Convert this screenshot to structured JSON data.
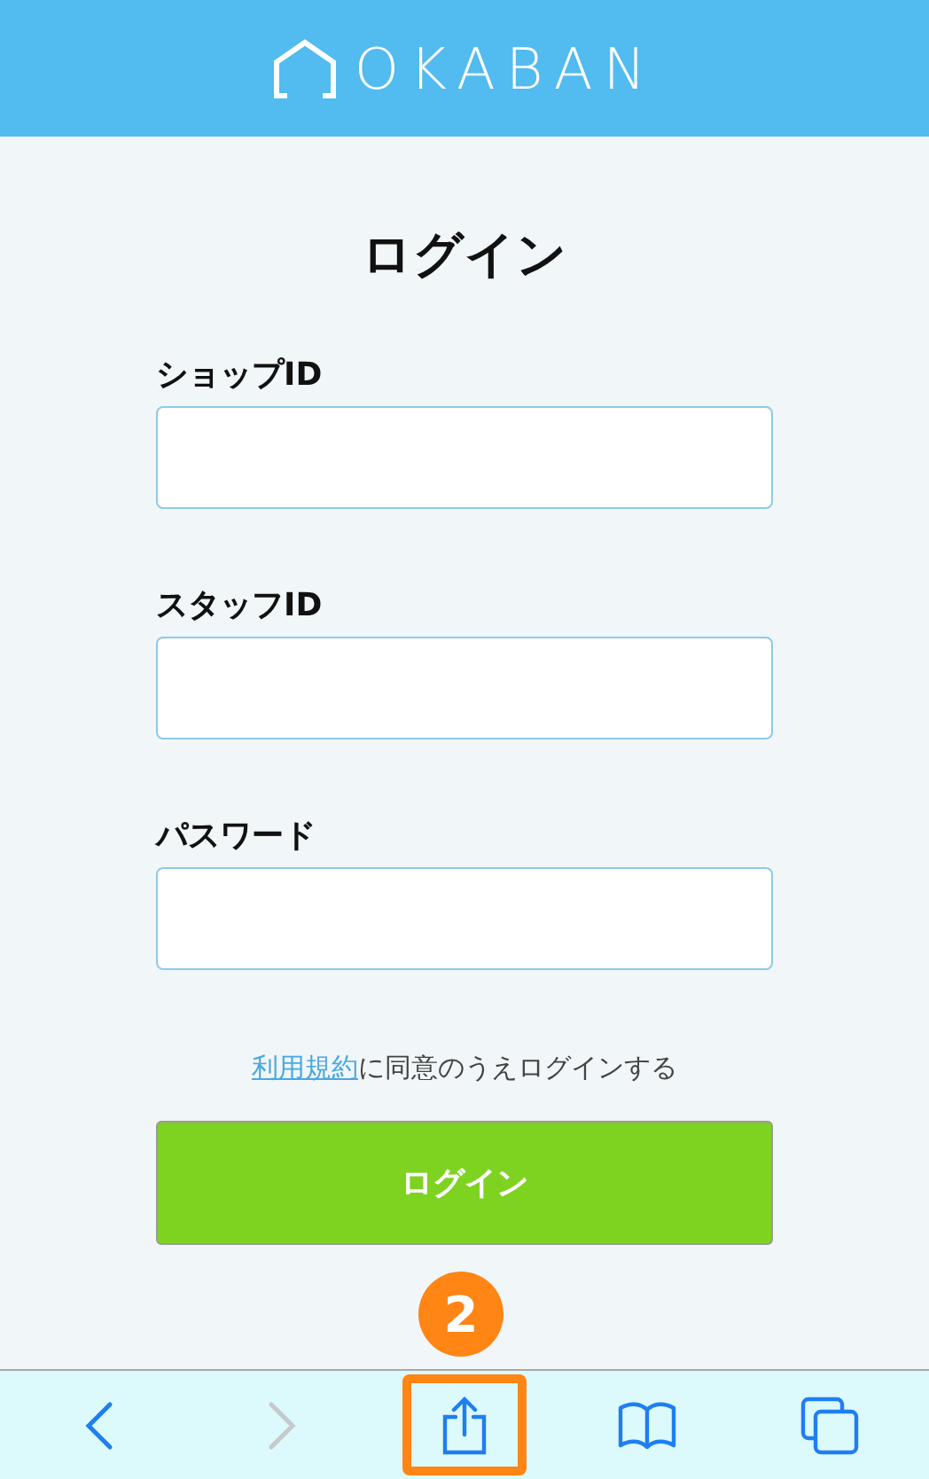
{
  "header": {
    "logo": "OKABAN"
  },
  "title": "ログイン",
  "fields": [
    {
      "label": "ショップID"
    },
    {
      "label": "スタッフID"
    },
    {
      "label": "パスワード"
    }
  ],
  "terms": {
    "link": "利用規約",
    "text": "に同意のうえログインする"
  },
  "submit": "ログイン",
  "callout": {
    "number": "2"
  },
  "toolbar": [
    {
      "kind": "back",
      "disabled": false,
      "highlighted": false
    },
    {
      "kind": "forward",
      "disabled": true,
      "highlighted": false
    },
    {
      "kind": "share",
      "disabled": false,
      "highlighted": true
    },
    {
      "kind": "bookmarks",
      "disabled": false,
      "highlighted": false
    },
    {
      "kind": "tabs",
      "disabled": false,
      "highlighted": false
    }
  ]
}
